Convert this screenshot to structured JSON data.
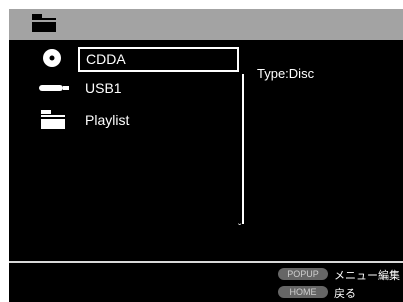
{
  "header": {
    "icon": "folder-icon"
  },
  "menu": {
    "items": [
      {
        "label": "CDDA",
        "icon": "disc-icon",
        "selected": true
      },
      {
        "label": "USB1",
        "icon": "usb-icon",
        "selected": false
      },
      {
        "label": "Playlist",
        "icon": "folder-icon",
        "selected": false
      }
    ]
  },
  "info": {
    "type_text": "Type:Disc"
  },
  "footer": {
    "popup_button": "POPUP",
    "popup_text": "メニュー編集",
    "home_button": "HOME",
    "home_text": "戻る"
  },
  "colors": {
    "topbar": "#a3a3a3",
    "background": "#000000",
    "text": "#ffffff",
    "pill": "#666666"
  }
}
